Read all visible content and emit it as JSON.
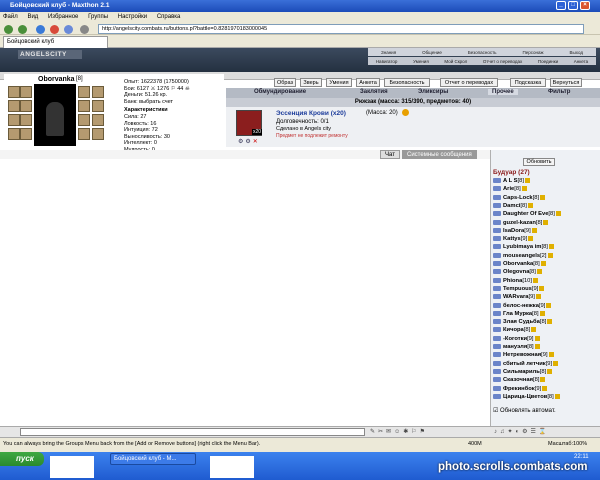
{
  "window": {
    "title": "Бойцовский клуб - Maxthon 2.1"
  },
  "menu": [
    "Файл",
    "Вид",
    "Избранное",
    "Группы",
    "Настройки",
    "Справка"
  ],
  "address": {
    "url": "http://angelscity.combats.ru/buttons.pl?battle=0.8281970183000045"
  },
  "tab": {
    "label": "Бойцовский клуб"
  },
  "header": {
    "logo": "ANGELSCITY",
    "links": [
      "Знания",
      "Общение",
      "Безопасность",
      "Персонаж",
      "Выход"
    ],
    "links2": [
      "Навигатор",
      "Умения",
      "Мой Скрол",
      "Отчет о переводах",
      "Поединки",
      "Анкета"
    ]
  },
  "player": {
    "name": "Oborvanka",
    "level": "[8]",
    "hp_label": "281/281",
    "stats": [
      "Опыт: 1622378 (1750000)",
      "Бои: 6127 ⚔ 1276 ⚐ 44 ☠",
      "Деньги: 51.26 кр.",
      "Банк: выбрать счет"
    ],
    "attributes": [
      "Сила: 27",
      "Ловкость: 16",
      "Интуиция: 72",
      "Выносливость: 30",
      "Интеллект: 0",
      "Мудрость: 0"
    ],
    "chars_label": "Характеристики"
  },
  "buttons": [
    "Образ",
    "Зверь",
    "Умения",
    "Анкета",
    "Безопасность",
    "Отчет о переводах",
    "Подсказка",
    "Вернуться"
  ],
  "categories": [
    "Обмундирование",
    "Заклятия",
    "Эликсиры",
    "Прочее",
    "Фильтр"
  ],
  "backpack": {
    "title": "Рюкзак (масса: 315/390, предметов: 40)"
  },
  "item": {
    "name": "Эссенция Крови (x20)",
    "mass": "(Масса: 20)",
    "durability": "Долговечность: 0/1",
    "made_in": "Сделано в Angels city",
    "note": "Предмет не подлежит ремонту",
    "count": "x20"
  },
  "chat": {
    "tab_chat": "Чат",
    "tab_system": "Системные сообщения"
  },
  "online": {
    "refresh": "Обновить",
    "room": "Будуар (27)",
    "users": [
      {
        "name": "A L S",
        "lv": "[8]"
      },
      {
        "name": "Arie",
        "lv": "[8]"
      },
      {
        "name": "Caps-Lock",
        "lv": "[8]"
      },
      {
        "name": "Damci",
        "lv": "[8]"
      },
      {
        "name": "Daughter Of Eve",
        "lv": "[8]"
      },
      {
        "name": "guzel-kazan",
        "lv": "[8]"
      },
      {
        "name": "IsaDora",
        "lv": "[9]"
      },
      {
        "name": "Kattys",
        "lv": "[9]"
      },
      {
        "name": "Lyubimaya im",
        "lv": "[8]"
      },
      {
        "name": "mouseangels",
        "lv": "[2]"
      },
      {
        "name": "Oborvanka",
        "lv": "[8]"
      },
      {
        "name": "Olegovna",
        "lv": "[8]"
      },
      {
        "name": "Phiona",
        "lv": "[10]"
      },
      {
        "name": "Tempuous",
        "lv": "[9]"
      },
      {
        "name": "WARvara",
        "lv": "[9]"
      },
      {
        "name": "белос-нежка",
        "lv": "[9]"
      },
      {
        "name": "Гла Мурка",
        "lv": "[8]"
      },
      {
        "name": "Злая Судьба",
        "lv": "[8]"
      },
      {
        "name": "Кичора",
        "lv": "[8]"
      },
      {
        "name": "-Коготки",
        "lv": "[9]"
      },
      {
        "name": "мануэля",
        "lv": "[8]"
      },
      {
        "name": "Нетревожная",
        "lv": "[9]"
      },
      {
        "name": "сбитый летчик",
        "lv": "[9]"
      },
      {
        "name": "Сильмариль",
        "lv": "[8]"
      },
      {
        "name": "Сказочная",
        "lv": "[8]"
      },
      {
        "name": "Фрекинбок",
        "lv": "[9]"
      },
      {
        "name": "Царица-Цветов",
        "lv": "[8]"
      }
    ],
    "autoupdate": "Обновлять автомат."
  },
  "status": {
    "text": "You can always bring the Groups Menu back from the [Add or Remove buttons] (right click the Menu Bar).",
    "memory": "400M",
    "zoom": "Масштаб:100%"
  },
  "taskbar": {
    "start": "пуск",
    "task": "Бойцовский клуб - M...",
    "time": "22:11"
  },
  "watermark": "photo.scrolls.combats.com"
}
